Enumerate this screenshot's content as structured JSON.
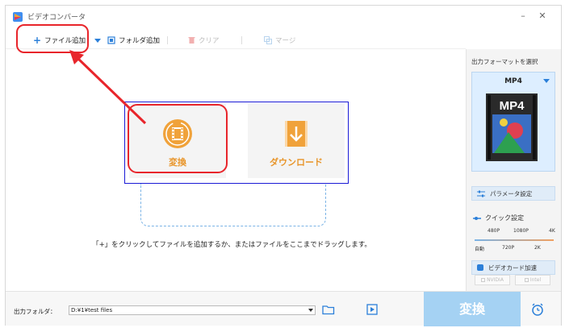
{
  "window": {
    "title": "ビデオコンバータ"
  },
  "toolbar": {
    "add_file": "ファイル追加",
    "add_folder": "フォルダ追加",
    "clear": "クリア",
    "merge": "マージ"
  },
  "modes": {
    "convert": "変換",
    "download": "ダウンロード"
  },
  "hint": "「+」をクリックしてファイルを追加するか、またはファイルをここまでドラッグします。",
  "side": {
    "title": "出力フォーマットを選択",
    "format": "MP4",
    "thumb_text": "MP4",
    "params": "パラメータ設定",
    "quick": "クイック設定",
    "quick_top": [
      "480P",
      "1080P",
      "4K"
    ],
    "quick_bottom": [
      "自動",
      "720P",
      "2K"
    ],
    "gpu": "ビデオカード加速",
    "nvidia": "NVIDIA",
    "intel": "Intel"
  },
  "footer": {
    "output_label": "出力フォルダ：",
    "output_path": "D:¥1¥test files",
    "convert": "変換"
  },
  "colors": {
    "accent_orange": "#f0a23a",
    "highlight_red": "#e8252b",
    "convert_blue": "#a5d2f3"
  }
}
